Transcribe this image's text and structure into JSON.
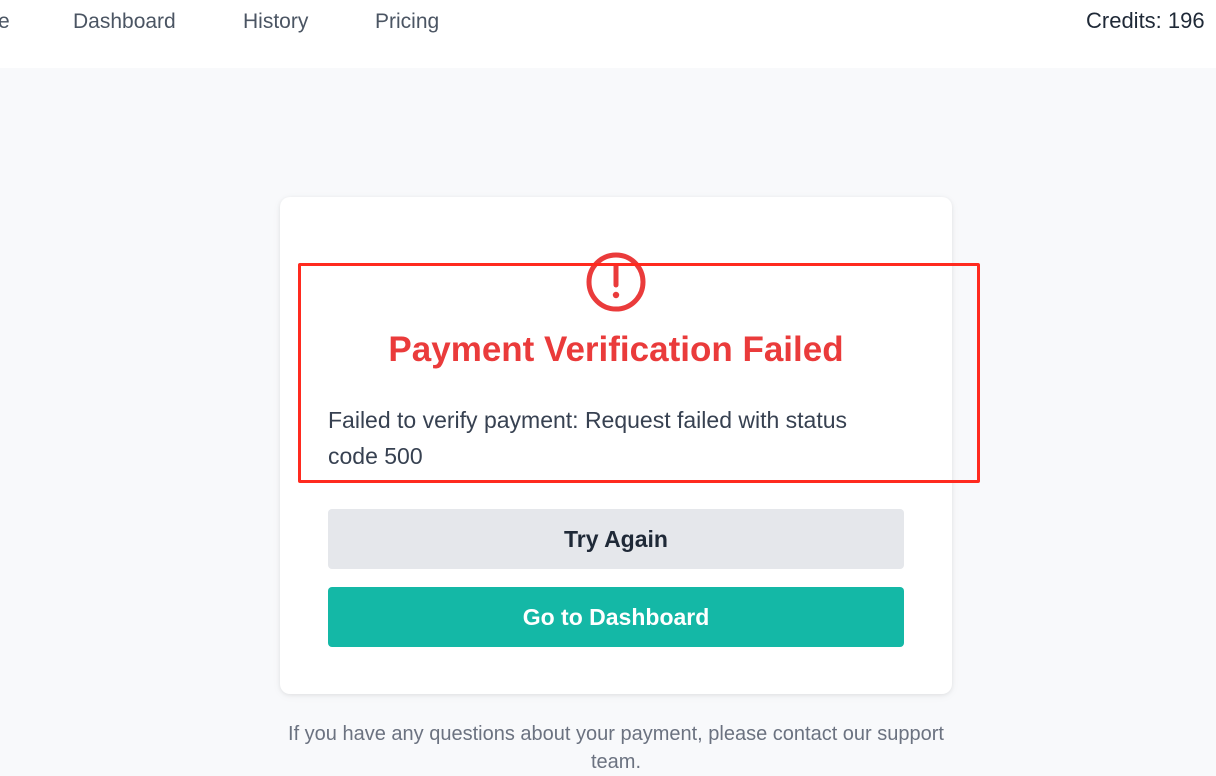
{
  "nav": {
    "partial_home": "e",
    "dashboard": "Dashboard",
    "history": "History",
    "pricing": "Pricing",
    "credits": "Credits: 196"
  },
  "card": {
    "icon": "alert-circle-icon",
    "title": "Payment Verification Failed",
    "message": "Failed to verify payment: Request failed with status code 500",
    "try_again_label": "Try Again",
    "dashboard_label": "Go to Dashboard"
  },
  "footer": {
    "note": "If you have any questions about your payment, please contact our support team."
  },
  "colors": {
    "error": "#ea3b3b",
    "accent": "#14b8a6",
    "highlight": "#ff2a1f"
  }
}
